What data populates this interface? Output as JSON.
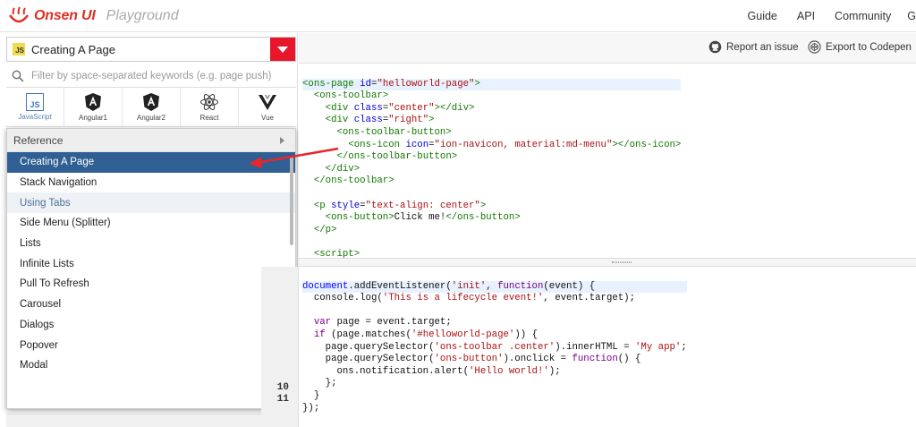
{
  "navbar": {
    "brand": "Onsen UI",
    "subtitle": "Playground",
    "links": [
      "Guide",
      "API",
      "Community",
      "G"
    ]
  },
  "left": {
    "select_badge": "JS",
    "select_value": "Creating A Page",
    "search_placeholder": "Filter by space-separated keywords (e.g. page push)",
    "frameworks": [
      {
        "label": "JavaScript",
        "icon": "javascript-icon"
      },
      {
        "label": "Angular1",
        "icon": "angular1-icon"
      },
      {
        "label": "Angular2",
        "icon": "angular2-icon"
      },
      {
        "label": "React",
        "icon": "react-icon"
      },
      {
        "label": "Vue",
        "icon": "vue-icon"
      }
    ],
    "menu_header": "Reference",
    "menu_items": [
      "Creating A Page",
      "Stack Navigation",
      "Using Tabs",
      "Side Menu (Splitter)",
      "Lists",
      "Infinite Lists",
      "Pull To Refresh",
      "Carousel",
      "Dialogs",
      "Popover",
      "Modal"
    ],
    "selected_item": "Creating A Page",
    "hover_item": "Using Tabs"
  },
  "toolbar": {
    "report_label": "Report an issue",
    "export_label": "Export to Codepen"
  },
  "gutter_numbers": [
    "10",
    "11"
  ],
  "colors": {
    "brand_red": "#e12f24",
    "select_arrow": "#e8162b",
    "selected_item": "#2f5f93",
    "annotation_arrow": "#e8262b"
  }
}
